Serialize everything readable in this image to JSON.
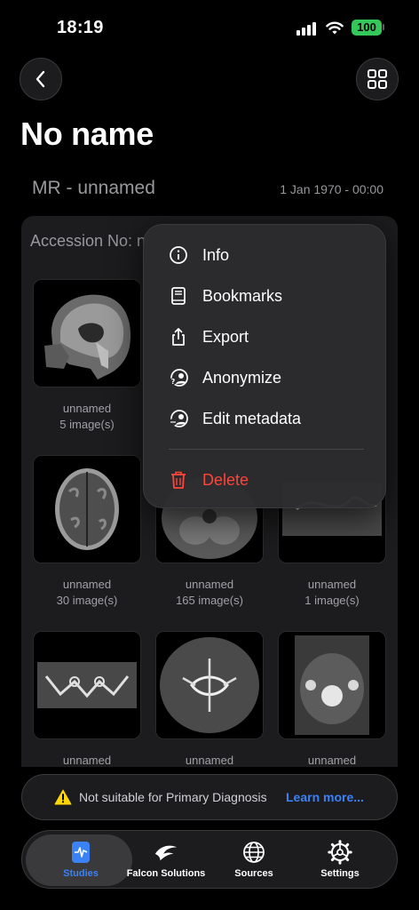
{
  "status_bar": {
    "time": "18:19",
    "battery": "100"
  },
  "header": {
    "title": "No name"
  },
  "series": {
    "title": "MR - unnamed",
    "date": "1 Jan 1970 - 00:00"
  },
  "study": {
    "accession_label": "Accession No: n",
    "items": [
      {
        "name": "unnamed",
        "count": "5 image(s)"
      },
      {
        "name": "unnamed",
        "count": "30 image(s)"
      },
      {
        "name": "unnamed",
        "count": "165 image(s)"
      },
      {
        "name": "unnamed",
        "count": "1 image(s)"
      },
      {
        "name": "unnamed",
        "count": ""
      },
      {
        "name": "unnamed",
        "count": ""
      },
      {
        "name": "unnamed",
        "count": ""
      }
    ]
  },
  "context_menu": {
    "items": [
      {
        "label": "Info",
        "icon": "info-icon"
      },
      {
        "label": "Bookmarks",
        "icon": "book-icon"
      },
      {
        "label": "Export",
        "icon": "share-icon"
      },
      {
        "label": "Anonymize",
        "icon": "anonymize-icon"
      },
      {
        "label": "Edit metadata",
        "icon": "edit-metadata-icon"
      },
      {
        "label": "Delete",
        "icon": "trash-icon",
        "color": "#ff453a"
      }
    ]
  },
  "banner": {
    "text": "Not suitable for Primary Diagnosis",
    "link": "Learn more..."
  },
  "tabs": [
    {
      "label": "Studies",
      "icon": "waveform-doc-icon",
      "active": true
    },
    {
      "label": "Falcon Solutions",
      "icon": "falcon-icon"
    },
    {
      "label": "Sources",
      "icon": "globe-icon"
    },
    {
      "label": "Settings",
      "icon": "gear-icon"
    }
  ],
  "colors": {
    "accent": "#3b82f6",
    "danger": "#ff453a",
    "battery": "#34c759",
    "warning": "#ffd60a"
  }
}
